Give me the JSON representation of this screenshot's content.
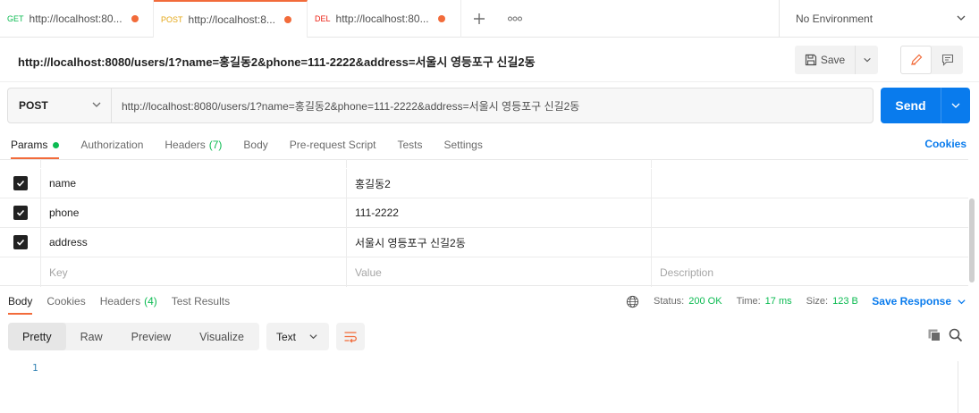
{
  "tabs": [
    {
      "method": "GET",
      "method_color": "#0cbb52",
      "url": "http://localhost:80...",
      "active": false
    },
    {
      "method": "POST",
      "method_color": "#e4a717",
      "url": "http://localhost:8...",
      "active": true
    },
    {
      "method": "DEL",
      "method_color": "#eb2013",
      "url": "http://localhost:80...",
      "active": false
    }
  ],
  "environment": "No Environment",
  "request": {
    "title": "http://localhost:8080/users/1?name=홍길동2&phone=111-2222&address=서울시 영등포구 신길2동",
    "method": "POST",
    "url": "http://localhost:8080/users/1?name=홍길동2&phone=111-2222&address=서울시 영등포구 신길2동",
    "save_label": "Save",
    "send_label": "Send"
  },
  "request_tabs": {
    "params": "Params",
    "authorization": "Authorization",
    "headers": "Headers",
    "headers_count": "(7)",
    "body": "Body",
    "prerequest": "Pre-request Script",
    "tests": "Tests",
    "settings": "Settings",
    "cookies": "Cookies"
  },
  "params": [
    {
      "key": "name",
      "value": "홍길동2",
      "checked": true
    },
    {
      "key": "phone",
      "value": "111-2222",
      "checked": true
    },
    {
      "key": "address",
      "value": "서울시 영등포구 신길2동",
      "checked": true
    }
  ],
  "params_placeholder": {
    "key": "Key",
    "value": "Value",
    "description": "Description"
  },
  "response_tabs": {
    "body": "Body",
    "cookies": "Cookies",
    "headers": "Headers",
    "headers_count": "(4)",
    "test_results": "Test Results"
  },
  "status": {
    "status_label": "Status:",
    "status_value": "200 OK",
    "time_label": "Time:",
    "time_value": "17 ms",
    "size_label": "Size:",
    "size_value": "123 B",
    "save_response": "Save Response"
  },
  "view_modes": [
    "Pretty",
    "Raw",
    "Preview",
    "Visualize"
  ],
  "format": "Text",
  "response_lines": [
    "1"
  ],
  "colors": {
    "accent": "#f26b3a",
    "primary": "#097bed",
    "success": "#0cbb52"
  }
}
